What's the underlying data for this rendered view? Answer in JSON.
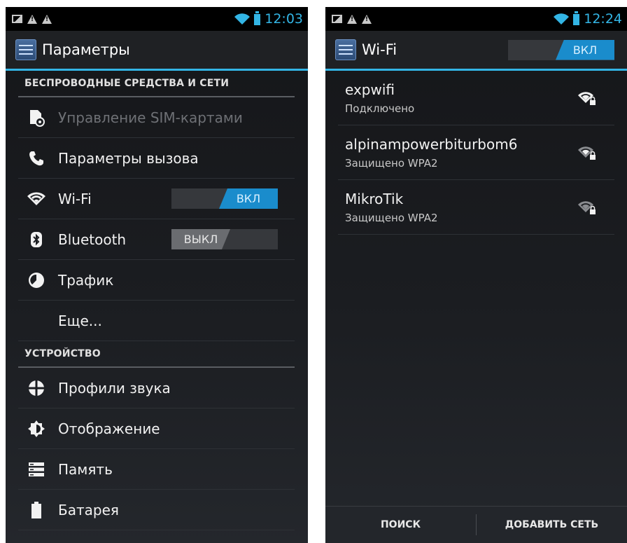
{
  "left": {
    "status": {
      "time": "12:03"
    },
    "actionbar": {
      "title": "Параметры"
    },
    "sections": [
      {
        "header": "БЕСПРОВОДНЫЕ СРЕДСТВА И СЕТИ"
      },
      {
        "header": "УСТРОЙСТВО"
      }
    ],
    "items": {
      "sim": "Управление SIM-картами",
      "call": "Параметры вызова",
      "wifi": "Wi-Fi",
      "bluetooth": "Bluetooth",
      "traffic": "Трафик",
      "more": "Еще...",
      "sound": "Профили звука",
      "display": "Отображение",
      "memory": "Память",
      "battery": "Батарея"
    },
    "toggles": {
      "wifi": "ВКЛ",
      "bluetooth": "ВЫКЛ"
    }
  },
  "right": {
    "status": {
      "time": "12:24"
    },
    "actionbar": {
      "title": "Wi-Fi",
      "toggle": "ВКЛ"
    },
    "networks": [
      {
        "ssid": "expwifi",
        "status": "Подключено",
        "icon": "wifi-lock-icon"
      },
      {
        "ssid": "alpinampowerbiturbom6",
        "status": "Защищено WPA2",
        "icon": "wifi-lock-icon"
      },
      {
        "ssid": "MikroTik",
        "status": "Защищено WPA2",
        "icon": "wifi-lock-icon"
      }
    ],
    "bottom": {
      "search": "ПОИСК",
      "add": "ДОБАВИТЬ СЕТЬ"
    }
  },
  "colors": {
    "accent": "#33b5e5",
    "toggle_on": "#1a8ccc",
    "toggle_off": "#6a6c70"
  }
}
